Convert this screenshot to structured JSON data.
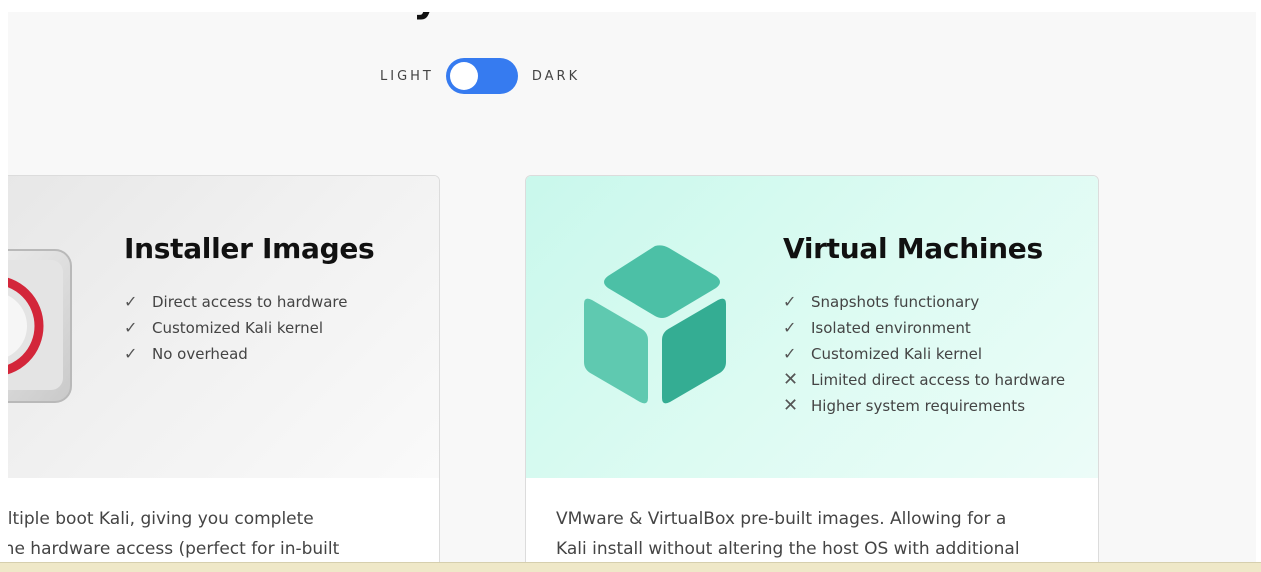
{
  "header": {
    "title_fragment": "y"
  },
  "theme_toggle": {
    "left_label": "LIGHT",
    "right_label": "DARK",
    "accent_color": "#367bf0"
  },
  "cards": {
    "installer": {
      "title": "Installer Images",
      "icon": "installer-disc-icon",
      "features": [
        {
          "mark": "✓",
          "text": "Direct access to hardware"
        },
        {
          "mark": "✓",
          "text": "Customized Kali kernel"
        },
        {
          "mark": "✓",
          "text": "No overhead"
        }
      ],
      "description": [
        "ultiple boot Kali, giving you complete",
        "the hardware access (perfect for in-built"
      ]
    },
    "vm": {
      "title": "Virtual Machines",
      "icon": "cube-icon",
      "cube_colors": [
        "#4cc0a6",
        "#5fc9b0",
        "#34ad93"
      ],
      "features": [
        {
          "mark": "✓",
          "text": "Snapshots functionary"
        },
        {
          "mark": "✓",
          "text": "Isolated environment"
        },
        {
          "mark": "✓",
          "text": "Customized Kali kernel"
        },
        {
          "mark": "✕",
          "text": "Limited direct access to hardware"
        },
        {
          "mark": "✕",
          "text": "Higher system requirements"
        }
      ],
      "description": [
        "VMware & VirtualBox pre-built images. Allowing for a",
        "Kali install without altering the host OS with additional"
      ]
    }
  }
}
